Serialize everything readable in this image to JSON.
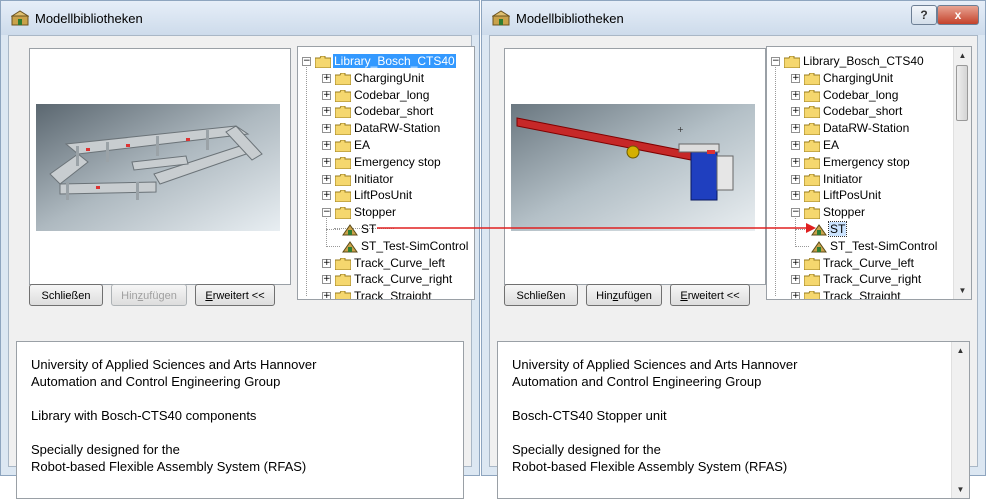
{
  "left": {
    "title": "Modellbibliotheken",
    "buttons": {
      "close": "Schließen",
      "add": "Hinzufügen",
      "advanced": "Erweitert <<"
    },
    "tree": {
      "root": "Library_Bosch_CTS40",
      "items": [
        "ChargingUnit",
        "Codebar_long",
        "Codebar_short",
        "DataRW-Station",
        "EA",
        "Emergency stop",
        "Initiator",
        "LiftPosUnit",
        "Stopper"
      ],
      "stopper_children": [
        "ST",
        "ST_Test-SimControl"
      ],
      "after": [
        "Track_Curve_left",
        "Track_Curve_right",
        "Track_Straight"
      ]
    },
    "description": {
      "line1": "University of Applied Sciences and Arts Hannover",
      "line2": "Automation and Control Engineering Group",
      "line3": "Library with Bosch-CTS40 components",
      "line4": "Specially designed for the",
      "line5": "Robot-based Flexible Assembly System (RFAS)"
    }
  },
  "right": {
    "title": "Modellbibliotheken",
    "controls": {
      "help": "?",
      "close": "x"
    },
    "buttons": {
      "close": "Schließen",
      "add": "Hinzufügen",
      "advanced": "Erweitert <<"
    },
    "tree": {
      "root": "Library_Bosch_CTS40",
      "items": [
        "ChargingUnit",
        "Codebar_long",
        "Codebar_short",
        "DataRW-Station",
        "EA",
        "Emergency stop",
        "Initiator",
        "LiftPosUnit",
        "Stopper"
      ],
      "stopper_children": [
        "ST",
        "ST_Test-SimControl"
      ],
      "after": [
        "Track_Curve_left",
        "Track_Curve_right",
        "Track_Straight"
      ]
    },
    "description": {
      "line1": "University of Applied Sciences and Arts Hannover",
      "line2": "Automation and Control Engineering Group",
      "line3": "Bosch-CTS40 Stopper unit",
      "line4": "Specially designed for the",
      "line5": "Robot-based Flexible Assembly System (RFAS)"
    }
  },
  "colors": {
    "arrow": "#e02020",
    "selection": "#3399ff",
    "window_frame": "#dce7f2"
  }
}
